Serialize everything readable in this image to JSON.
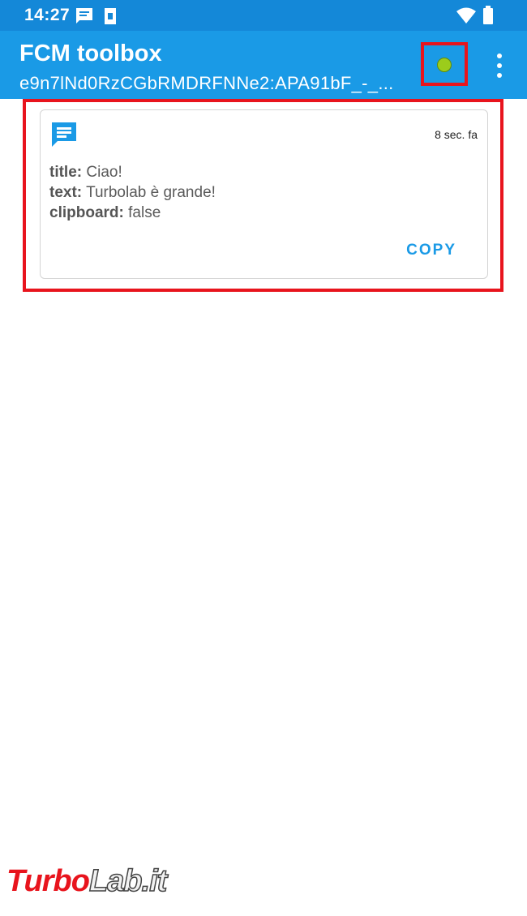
{
  "status_bar": {
    "time": "14:27"
  },
  "app_bar": {
    "title": "FCM toolbox",
    "token": "e9n7lNd0RzCGbRMDRFNNe2:APA91bF_-_...",
    "connection_color": "#9ccc1b"
  },
  "messages": [
    {
      "time": "8 sec. fa",
      "fields": [
        {
          "key": "title:",
          "value": "Ciao!"
        },
        {
          "key": "text:",
          "value": "Turbolab è grande!"
        },
        {
          "key": "clipboard:",
          "value": "false"
        }
      ],
      "action_label": "COPY"
    }
  ],
  "watermark": {
    "part1": "Turbo",
    "part2": "Lab.it"
  },
  "colors": {
    "app_bar": "#1a9ae6",
    "status_bar": "#1488d8",
    "highlight": "#e8141d",
    "accent": "#1a9ae6"
  }
}
